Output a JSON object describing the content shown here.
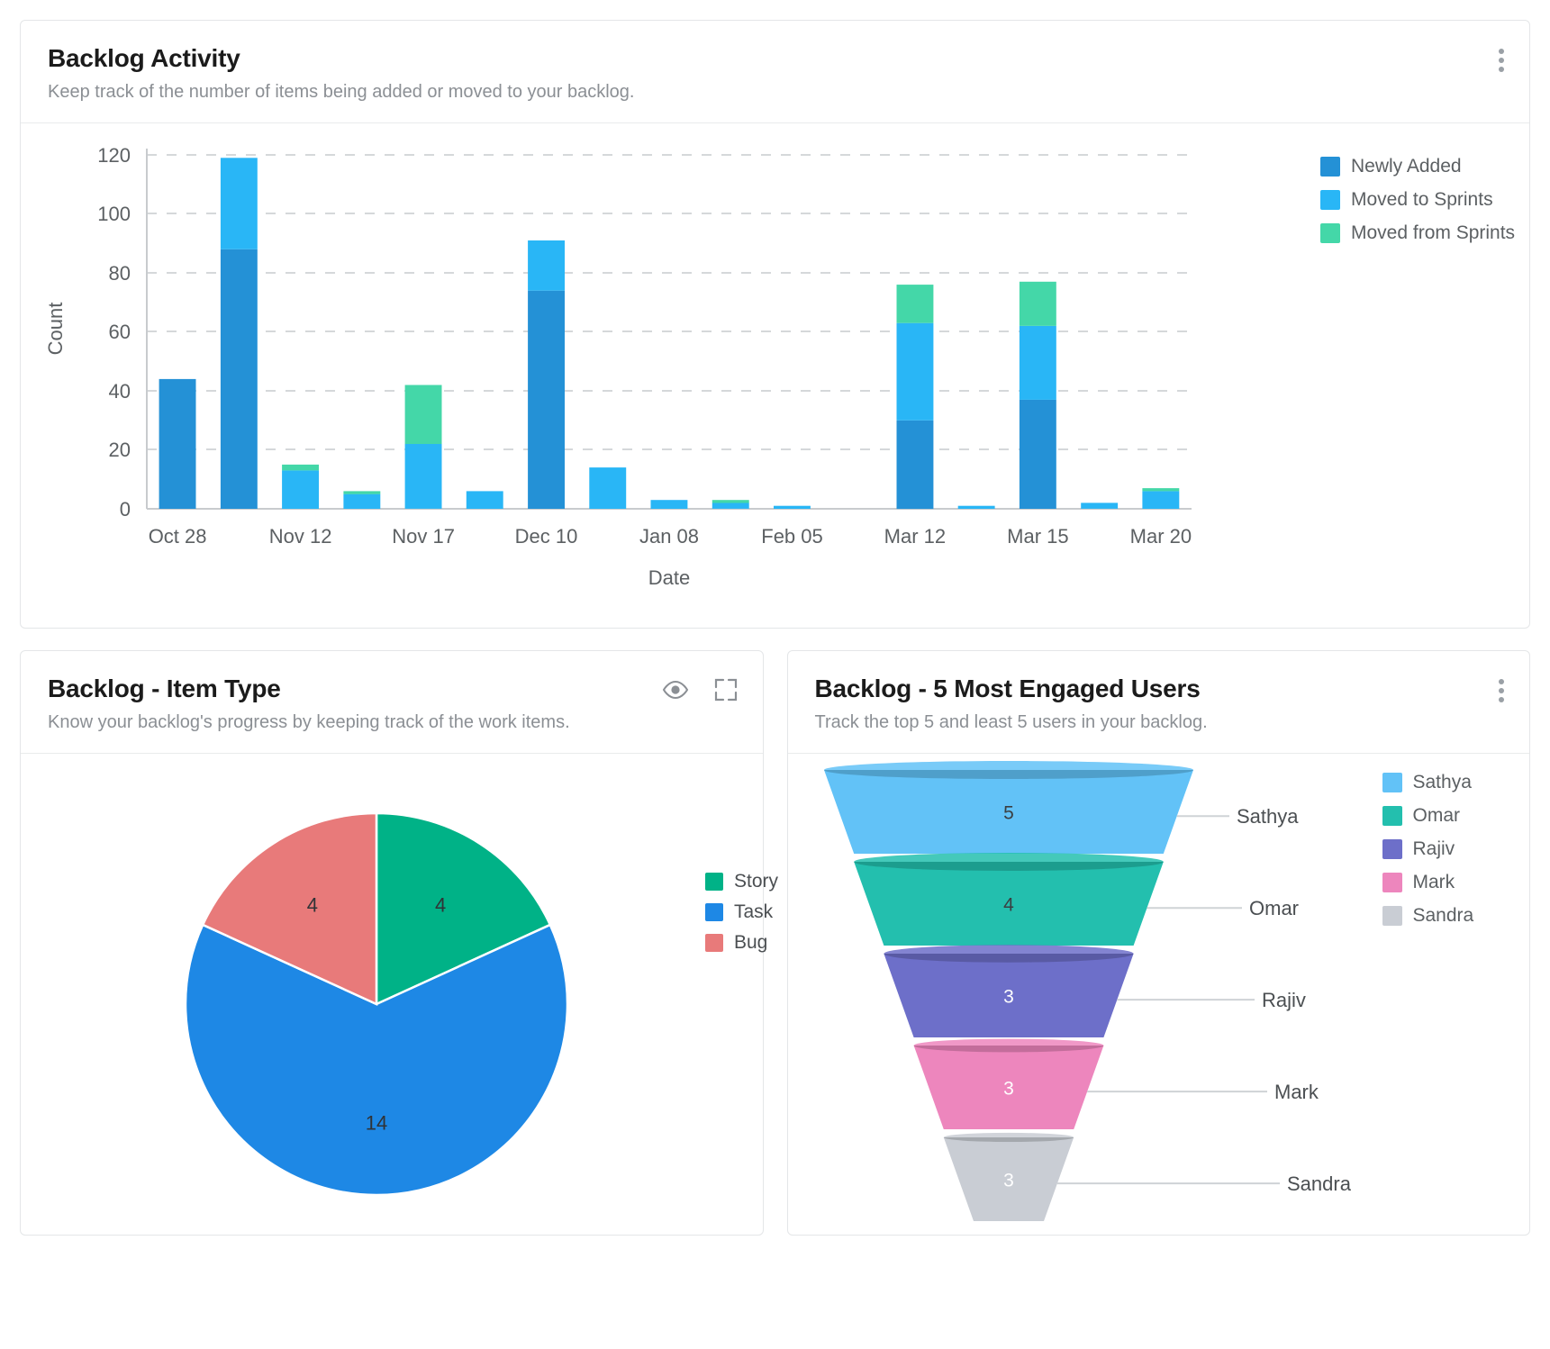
{
  "backlog_activity": {
    "title": "Backlog Activity",
    "subtitle": "Keep track of the number of items being added or moved to your backlog.",
    "menu_icon": "kebab-menu-icon",
    "chart_data": {
      "type": "bar",
      "stacked": true,
      "title": "Backlog Activity",
      "xlabel": "Date",
      "ylabel": "Count",
      "ylim": [
        0,
        125
      ],
      "yticks": [
        0,
        20,
        40,
        60,
        80,
        100,
        120
      ],
      "grid": true,
      "legend_position": "right",
      "tick_labels": [
        "Oct 28",
        "Nov 12",
        "Nov 17",
        "Dec 10",
        "Jan 08",
        "Feb 05",
        "Mar 12",
        "Mar 15",
        "Mar 20"
      ],
      "categories": [
        "Oct 28",
        "",
        "Nov 12",
        "",
        "Nov 17",
        "",
        "Dec 10",
        "",
        "Jan 08",
        "",
        "Feb 05",
        "",
        "Mar 12",
        "",
        "Mar 15",
        "",
        "Mar 20"
      ],
      "series": [
        {
          "name": "Newly Added",
          "color": "#2491d6",
          "values": [
            44,
            88,
            0,
            0,
            0,
            0,
            74,
            0,
            0,
            0,
            0,
            0,
            30,
            0,
            37,
            0,
            0
          ]
        },
        {
          "name": "Moved to Sprints",
          "color": "#29b6f6",
          "values": [
            0,
            31,
            13,
            5,
            22,
            6,
            17,
            14,
            3,
            2,
            1,
            0,
            33,
            1,
            25,
            2,
            6
          ]
        },
        {
          "name": "Moved from Sprints",
          "color": "#44d7a8",
          "values": [
            0,
            0,
            2,
            1,
            20,
            0,
            0,
            0,
            0,
            1,
            0,
            0,
            13,
            0,
            15,
            0,
            1
          ]
        }
      ],
      "bar_totals": [
        44,
        119,
        15,
        6,
        42,
        6,
        91,
        14,
        3,
        3,
        1,
        0,
        76,
        1,
        77,
        2,
        7
      ]
    }
  },
  "item_type": {
    "title": "Backlog - Item Type",
    "subtitle": "Know your backlog's progress by keeping track of the work items.",
    "eye_icon": "eye-icon",
    "expand_icon": "expand-icon",
    "chart_data": {
      "type": "pie",
      "title": "Backlog - Item Type",
      "legend_position": "right",
      "labels": [
        "Story",
        "Task",
        "Bug"
      ],
      "values": [
        4,
        14,
        4
      ],
      "colors": [
        "#00b287",
        "#1e88e5",
        "#e87a7a"
      ],
      "slice_labels": [
        "4",
        "14",
        "4"
      ]
    }
  },
  "engaged_users": {
    "title": "Backlog - 5 Most Engaged Users",
    "subtitle": "Track the top 5 and least 5 users in your backlog.",
    "menu_icon": "kebab-menu-icon",
    "chart_data": {
      "type": "funnel",
      "title": "Backlog - 5 Most Engaged Users",
      "legend_position": "right",
      "labels": [
        "Sathya",
        "Omar",
        "Rajiv",
        "Mark",
        "Sandra"
      ],
      "values": [
        5,
        4,
        3,
        3,
        3
      ],
      "colors": [
        "#62c2f7",
        "#23bfae",
        "#6d6fc9",
        "#ed86bd",
        "#c9cdd4"
      ],
      "value_labels": [
        "5",
        "4",
        "3",
        "3",
        "3"
      ]
    }
  }
}
